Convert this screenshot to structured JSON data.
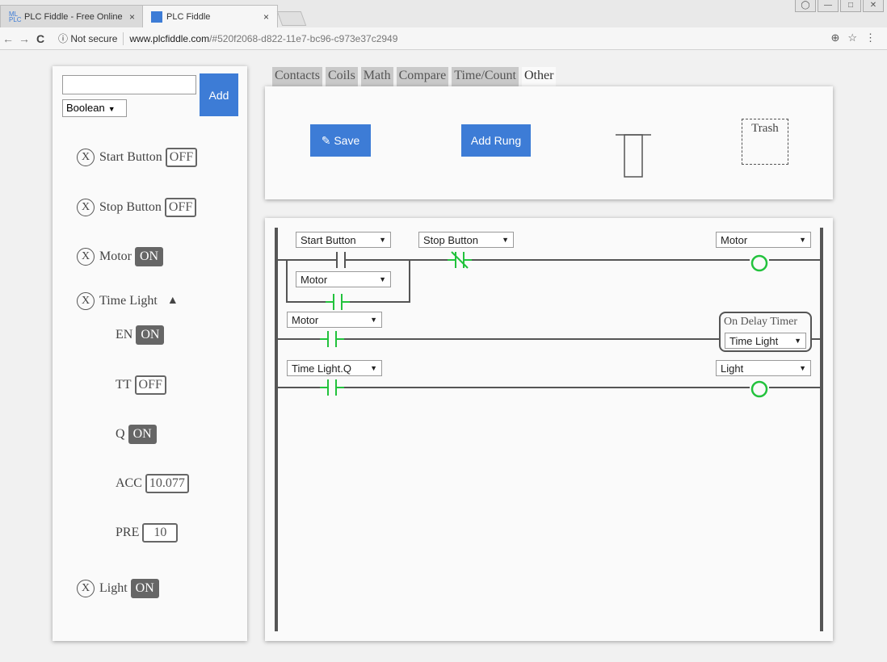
{
  "browser": {
    "tabs": [
      {
        "title": "PLC Fiddle - Free Online",
        "close": "×"
      },
      {
        "title": "PLC Fiddle",
        "close": "×"
      }
    ],
    "security": "Not secure",
    "url_host": "www.plcfiddle.com",
    "url_rest": "/#520f2068-d822-11e7-bc96-c973e37c2949",
    "icons": [
      "back-icon",
      "forward-icon",
      "reload-icon",
      "info-icon",
      "zoom-icon",
      "star-icon",
      "menu-icon"
    ]
  },
  "sidebar": {
    "new_tag_value": "",
    "add_label": "Add",
    "type_value": "Boolean",
    "remove_glyph": "X",
    "tags": {
      "start_button": {
        "name": "Start Button",
        "value": "OFF"
      },
      "stop_button": {
        "name": "Stop Button",
        "value": "OFF"
      },
      "motor": {
        "name": "Motor",
        "value": "ON"
      },
      "time_light": {
        "name": "Time Light",
        "toggle": "▲",
        "en": {
          "label": "EN",
          "value": "ON"
        },
        "tt": {
          "label": "TT",
          "value": "OFF"
        },
        "q": {
          "label": "Q",
          "value": "ON"
        },
        "acc": {
          "label": "ACC",
          "value": "10.077"
        },
        "pre": {
          "label": "PRE",
          "value": "10"
        }
      },
      "light": {
        "name": "Light",
        "value": "ON"
      }
    }
  },
  "toolbox": {
    "tabs": [
      "Contacts",
      "Coils",
      "Math",
      "Compare",
      "Time/Count",
      "Other"
    ],
    "active_tab": "Other",
    "save_label": "Save",
    "save_icon": "pencil-icon",
    "add_rung_label": "Add Rung",
    "trash_label": "Trash"
  },
  "ladder": {
    "rung1": {
      "contact1": "Start Button",
      "contact2": "Stop Button",
      "branch_contact": "Motor",
      "coil": "Motor"
    },
    "rung2": {
      "contact": "Motor",
      "timer_title": "On Delay Timer",
      "timer_tag": "Time Light"
    },
    "rung3": {
      "contact": "Time Light.Q",
      "coil": "Light"
    },
    "colors": {
      "energized": "#22c23c",
      "wire": "#555555",
      "button": "#3d7cd6"
    }
  }
}
